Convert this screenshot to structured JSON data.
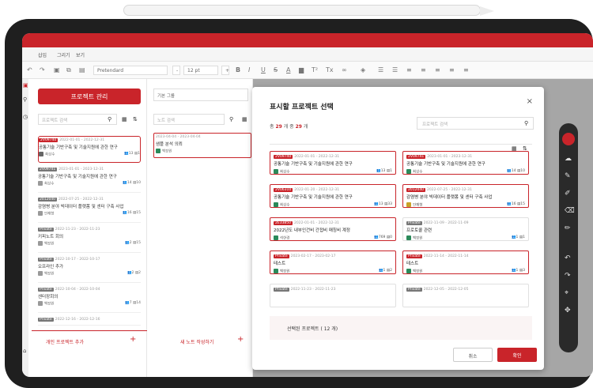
{
  "menu": [
    "삽입",
    "그리기",
    "보기"
  ],
  "toolbar": {
    "font": "Pretendard",
    "size": "12 pt",
    "glyphs": [
      "B",
      "I",
      "U",
      "S",
      "A",
      "T²",
      "Tx"
    ]
  },
  "projects": {
    "header_button": "프로젝트 관리",
    "search_placeholder": "프로젝트 검색",
    "add_label": "개인 프로젝트 추가",
    "items": [
      {
        "tag": "2V09740",
        "date": "2022-01-01 - 2022-12-31",
        "title": "공통기술 기반구축 및 기술지원에 관한 연구",
        "user": "최상수",
        "members": "13",
        "notes": "1"
      },
      {
        "tag": "2V09741",
        "date": "2023-01-01 - 2023-12-31",
        "title": "공통기술 기반구축 및 기술지원에 관한 연구",
        "user": "최상수",
        "members": "14",
        "notes": "10"
      },
      {
        "tag": "2012040",
        "date": "2022-07-25 - 2022-12-31",
        "title": "감염병 분야 빅데이터 플랫폼 및 센터 구축 사업",
        "user": "안재형",
        "members": "16",
        "notes": "15"
      },
      {
        "tag": "Private",
        "date": "2022-11-23 - 2022-11-23",
        "title": "키피노트 회의",
        "user": "백장원",
        "members": "2",
        "notes": "15"
      },
      {
        "tag": "Private",
        "date": "2022-10-17 - 2022-10-17",
        "title": "오프라인 추가",
        "user": "백장원",
        "members": "2",
        "notes": "2"
      },
      {
        "tag": "Private",
        "date": "2022-10-04 - 2022-10-04",
        "title": "센터장회의",
        "user": "백장원",
        "members": "7",
        "notes": "14"
      },
      {
        "tag": "Private",
        "date": "2022-12-16 - 2022-12-16",
        "title": "",
        "user": "",
        "members": "",
        "notes": ""
      }
    ]
  },
  "notes": {
    "template_label": "기본 그룹",
    "search_placeholder": "노트 검색",
    "add_label": "새 노트 작성하기",
    "item": {
      "date": "2023-04-04 - 2023-04-04",
      "title": "샘플 분석 의뢰",
      "user": "백장원"
    }
  },
  "modal": {
    "title": "표시할 프로젝트 선택",
    "count_prefix": "총",
    "count_total": "29",
    "count_mid": "개 중",
    "count_selected": "29",
    "count_suffix": "개",
    "search_placeholder": "프로젝트 검색",
    "selected_label": "선택된 프로젝트 ( 12 개)",
    "cancel": "취소",
    "confirm": "확인",
    "cards": [
      {
        "tag": "2V09740",
        "date": "2022-01-01 - 2022-12-31",
        "title": "공통기술 기반구축 및 기술지원에 관한 연구",
        "user": "최상수",
        "members": "13",
        "notes": "1",
        "sel": true
      },
      {
        "tag": "2V09741",
        "date": "2023-01-01 - 2023-12-31",
        "title": "공통기술 기반구축 및 기술지원에 관한 연구",
        "user": "최상수",
        "members": "14",
        "notes": "10",
        "sel": true
      },
      {
        "tag": "2V06310",
        "date": "2022-01-20 - 2022-12-31",
        "title": "공통기술 기반구축 및 기술지원에 관한 연구",
        "user": "최상수",
        "members": "13",
        "notes": "33",
        "sel": true
      },
      {
        "tag": "2012040",
        "date": "2022-07-25 - 2022-12-31",
        "title": "감염병 분야 빅데이터 플랫폼 및 센터 구축 사업",
        "user": "안재형",
        "members": "16",
        "notes": "15",
        "sel": true
      },
      {
        "tag": "2E33850",
        "date": "2022-01-01 - 2022-12-31",
        "title": "2022년도 내부인건비 간접비 매칭비 계정",
        "user": "석한경",
        "members": "769",
        "notes": "0",
        "sel": true
      },
      {
        "tag": "Private",
        "date": "2022-11-09 - 2022-11-09",
        "title": "프로토콜 관련",
        "user": "백장원",
        "members": "1",
        "notes": "1",
        "sel": false
      },
      {
        "tag": "Private",
        "date": "2023-02-17 - 2023-02-17",
        "title": "테스트",
        "user": "백장원",
        "members": "1",
        "notes": "2",
        "sel": true
      },
      {
        "tag": "Private",
        "date": "2022-11-14 - 2022-11-14",
        "title": "테스트",
        "user": "백장원",
        "members": "1",
        "notes": "3",
        "sel": true
      },
      {
        "tag": "Private",
        "date": "2022-11-23 - 2022-11-23",
        "title": "",
        "user": "",
        "members": "",
        "notes": "",
        "sel": false
      },
      {
        "tag": "Private",
        "date": "2022-12-05 - 2022-12-05",
        "title": "",
        "user": "",
        "members": "",
        "notes": "",
        "sel": false
      }
    ]
  },
  "colors": {
    "accent": "#c9242a"
  }
}
